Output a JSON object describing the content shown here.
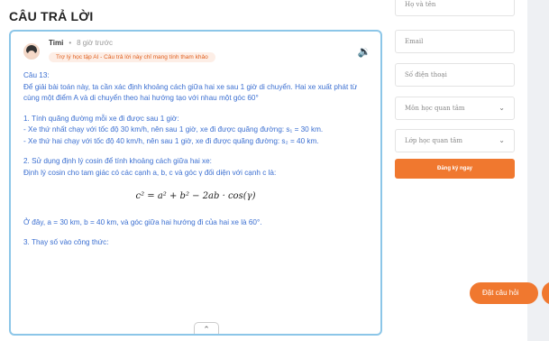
{
  "page": {
    "title": "CÂU TRẢ LỜI"
  },
  "answer": {
    "author": "Timi",
    "time": "8 giờ trước",
    "badge": "Trợ lý học tập AI - Câu trả lời này chỉ mang tính tham khảo",
    "question_label": "Câu 13:",
    "intro": "Để giải bài toán này, ta cần xác định khoảng cách giữa hai xe sau 1 giờ di chuyển. Hai xe xuất phát từ cùng một điểm A và di chuyển theo hai hướng tạo với nhau một góc 60°",
    "step1_title": "1. Tính quãng đường mỗi xe đi được sau 1 giờ:",
    "step1_a": " - Xe thứ nhất chạy với tốc độ 30 km/h, nên sau 1 giờ, xe đi được quãng đường: s₁ = 30 km.",
    "step1_b": " - Xe thứ hai chạy với tốc độ 40 km/h, nên sau 1 giờ, xe đi được quãng đường: s₂ = 40 km.",
    "step2_title": "2. Sử dụng định lý cosin để tính khoảng cách giữa hai xe:",
    "step2_text": " Định lý cosin cho tam giác có các cạnh a, b, c và góc γ đối diện với cạnh c là:",
    "formula": "c² = a² + b² − 2ab · cos(γ)",
    "values_text": "Ở đây, a = 30 km, b = 40 km, và góc giữa hai hướng đi của hai xe là 60°.",
    "step3_title": "3. Thay số vào công thức:"
  },
  "form": {
    "name_placeholder": "Họ và tên",
    "email_placeholder": "Email",
    "phone_placeholder": "Số điện thoại",
    "subject_placeholder": "Môn học quan tâm",
    "grade_placeholder": "Lớp học quan tâm",
    "submit_label": "Đăng ký ngay"
  },
  "ask_button_label": "Đặt câu hỏi",
  "colors": {
    "accent": "#f0782f",
    "card_border": "#8cc6e8",
    "text_blue": "#3b6fd1"
  }
}
